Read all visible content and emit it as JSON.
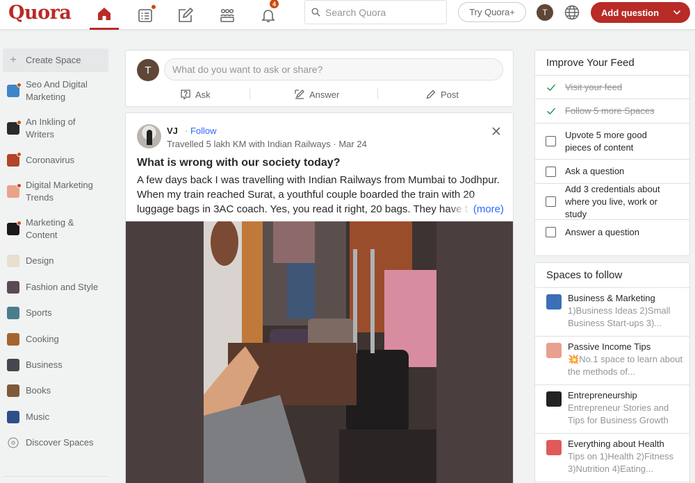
{
  "header": {
    "logo": "Quora",
    "notification_count": "4",
    "search_placeholder": "Search Quora",
    "try_plus": "Try Quora+",
    "user_initial": "T",
    "add_question": "Add question"
  },
  "sidebar": {
    "create_space": "Create Space",
    "items": [
      {
        "label": "Seo And Digital Marketing",
        "icon": "seo-space-icon",
        "color": "#3e86c9",
        "dot": true
      },
      {
        "label": "An Inkling of Writers",
        "icon": "writers-space-icon",
        "color": "#2a2a2a",
        "dot": true
      },
      {
        "label": "Coronavirus",
        "icon": "coronavirus-space-icon",
        "color": "#b1442a",
        "dot": true
      },
      {
        "label": "Digital Marketing Trends",
        "icon": "digital-trends-space-icon",
        "color": "#e9a38a",
        "dot": true
      },
      {
        "label": "Marketing & Content",
        "icon": "marketing-space-icon",
        "color": "#1a1a1a",
        "dot": true
      },
      {
        "label": "Design",
        "icon": "design-topic-icon",
        "color": "#e9dfcf",
        "dot": false
      },
      {
        "label": "Fashion and Style",
        "icon": "fashion-topic-icon",
        "color": "#5a4a55",
        "dot": false
      },
      {
        "label": "Sports",
        "icon": "sports-topic-icon",
        "color": "#4a7d8c",
        "dot": false
      },
      {
        "label": "Cooking",
        "icon": "cooking-topic-icon",
        "color": "#a5642e",
        "dot": false
      },
      {
        "label": "Business",
        "icon": "business-topic-icon",
        "color": "#44474d",
        "dot": false
      },
      {
        "label": "Books",
        "icon": "books-topic-icon",
        "color": "#7d5a3a",
        "dot": false
      },
      {
        "label": "Music",
        "icon": "music-topic-icon",
        "color": "#2d4f8a",
        "dot": false
      }
    ],
    "discover": "Discover Spaces"
  },
  "ask": {
    "user_initial": "T",
    "placeholder": "What do you want to ask or share?",
    "ask_label": "Ask",
    "answer_label": "Answer",
    "post_label": "Post"
  },
  "post": {
    "author": "VJ",
    "follow": "Follow",
    "separator": "·",
    "credential": "Travelled 5 lakh KM with Indian Railways · Mar 24",
    "title": "What is wrong with our society today?",
    "body": "A few days back I was travelling with Indian Railways from Mumbai to Jodhpur. When my train reached Surat, a youthful couple boarded the train with 20 luggage bags in 3AC coach. Yes, you read it right, 20 bags. They have t",
    "more": "(more)"
  },
  "improve_feed": {
    "title": "Improve Your Feed",
    "tasks": [
      {
        "label": "Visit your feed",
        "done": true
      },
      {
        "label": "Follow 5 more Spaces",
        "done": true
      },
      {
        "label": "Upvote 5 more good pieces of content",
        "done": false
      },
      {
        "label": "Ask a question",
        "done": false
      },
      {
        "label": "Add 3 credentials about where you live, work or study",
        "done": false
      },
      {
        "label": "Answer a question",
        "done": false
      }
    ]
  },
  "spaces_to_follow": {
    "title": "Spaces to follow",
    "items": [
      {
        "title": "Business & Marketing",
        "desc": "1)Business Ideas 2)Small Business Start-ups 3)...",
        "color": "#3b6fb6"
      },
      {
        "title": "Passive Income Tips",
        "desc": "💥No.1 space to learn about the methods of...",
        "color": "#e8a090"
      },
      {
        "title": "Entrepreneurship",
        "desc": "Entrepreneur Stories and Tips for Business Growth",
        "color": "#222222"
      },
      {
        "title": "Everything about Health",
        "desc": "Tips on 1)Health 2)Fitness 3)Nutrition 4)Eating...",
        "color": "#e05a5a"
      }
    ]
  },
  "colors": {
    "brand": "#b92b27",
    "link": "#2e69ff",
    "notification": "#cb4b10"
  }
}
